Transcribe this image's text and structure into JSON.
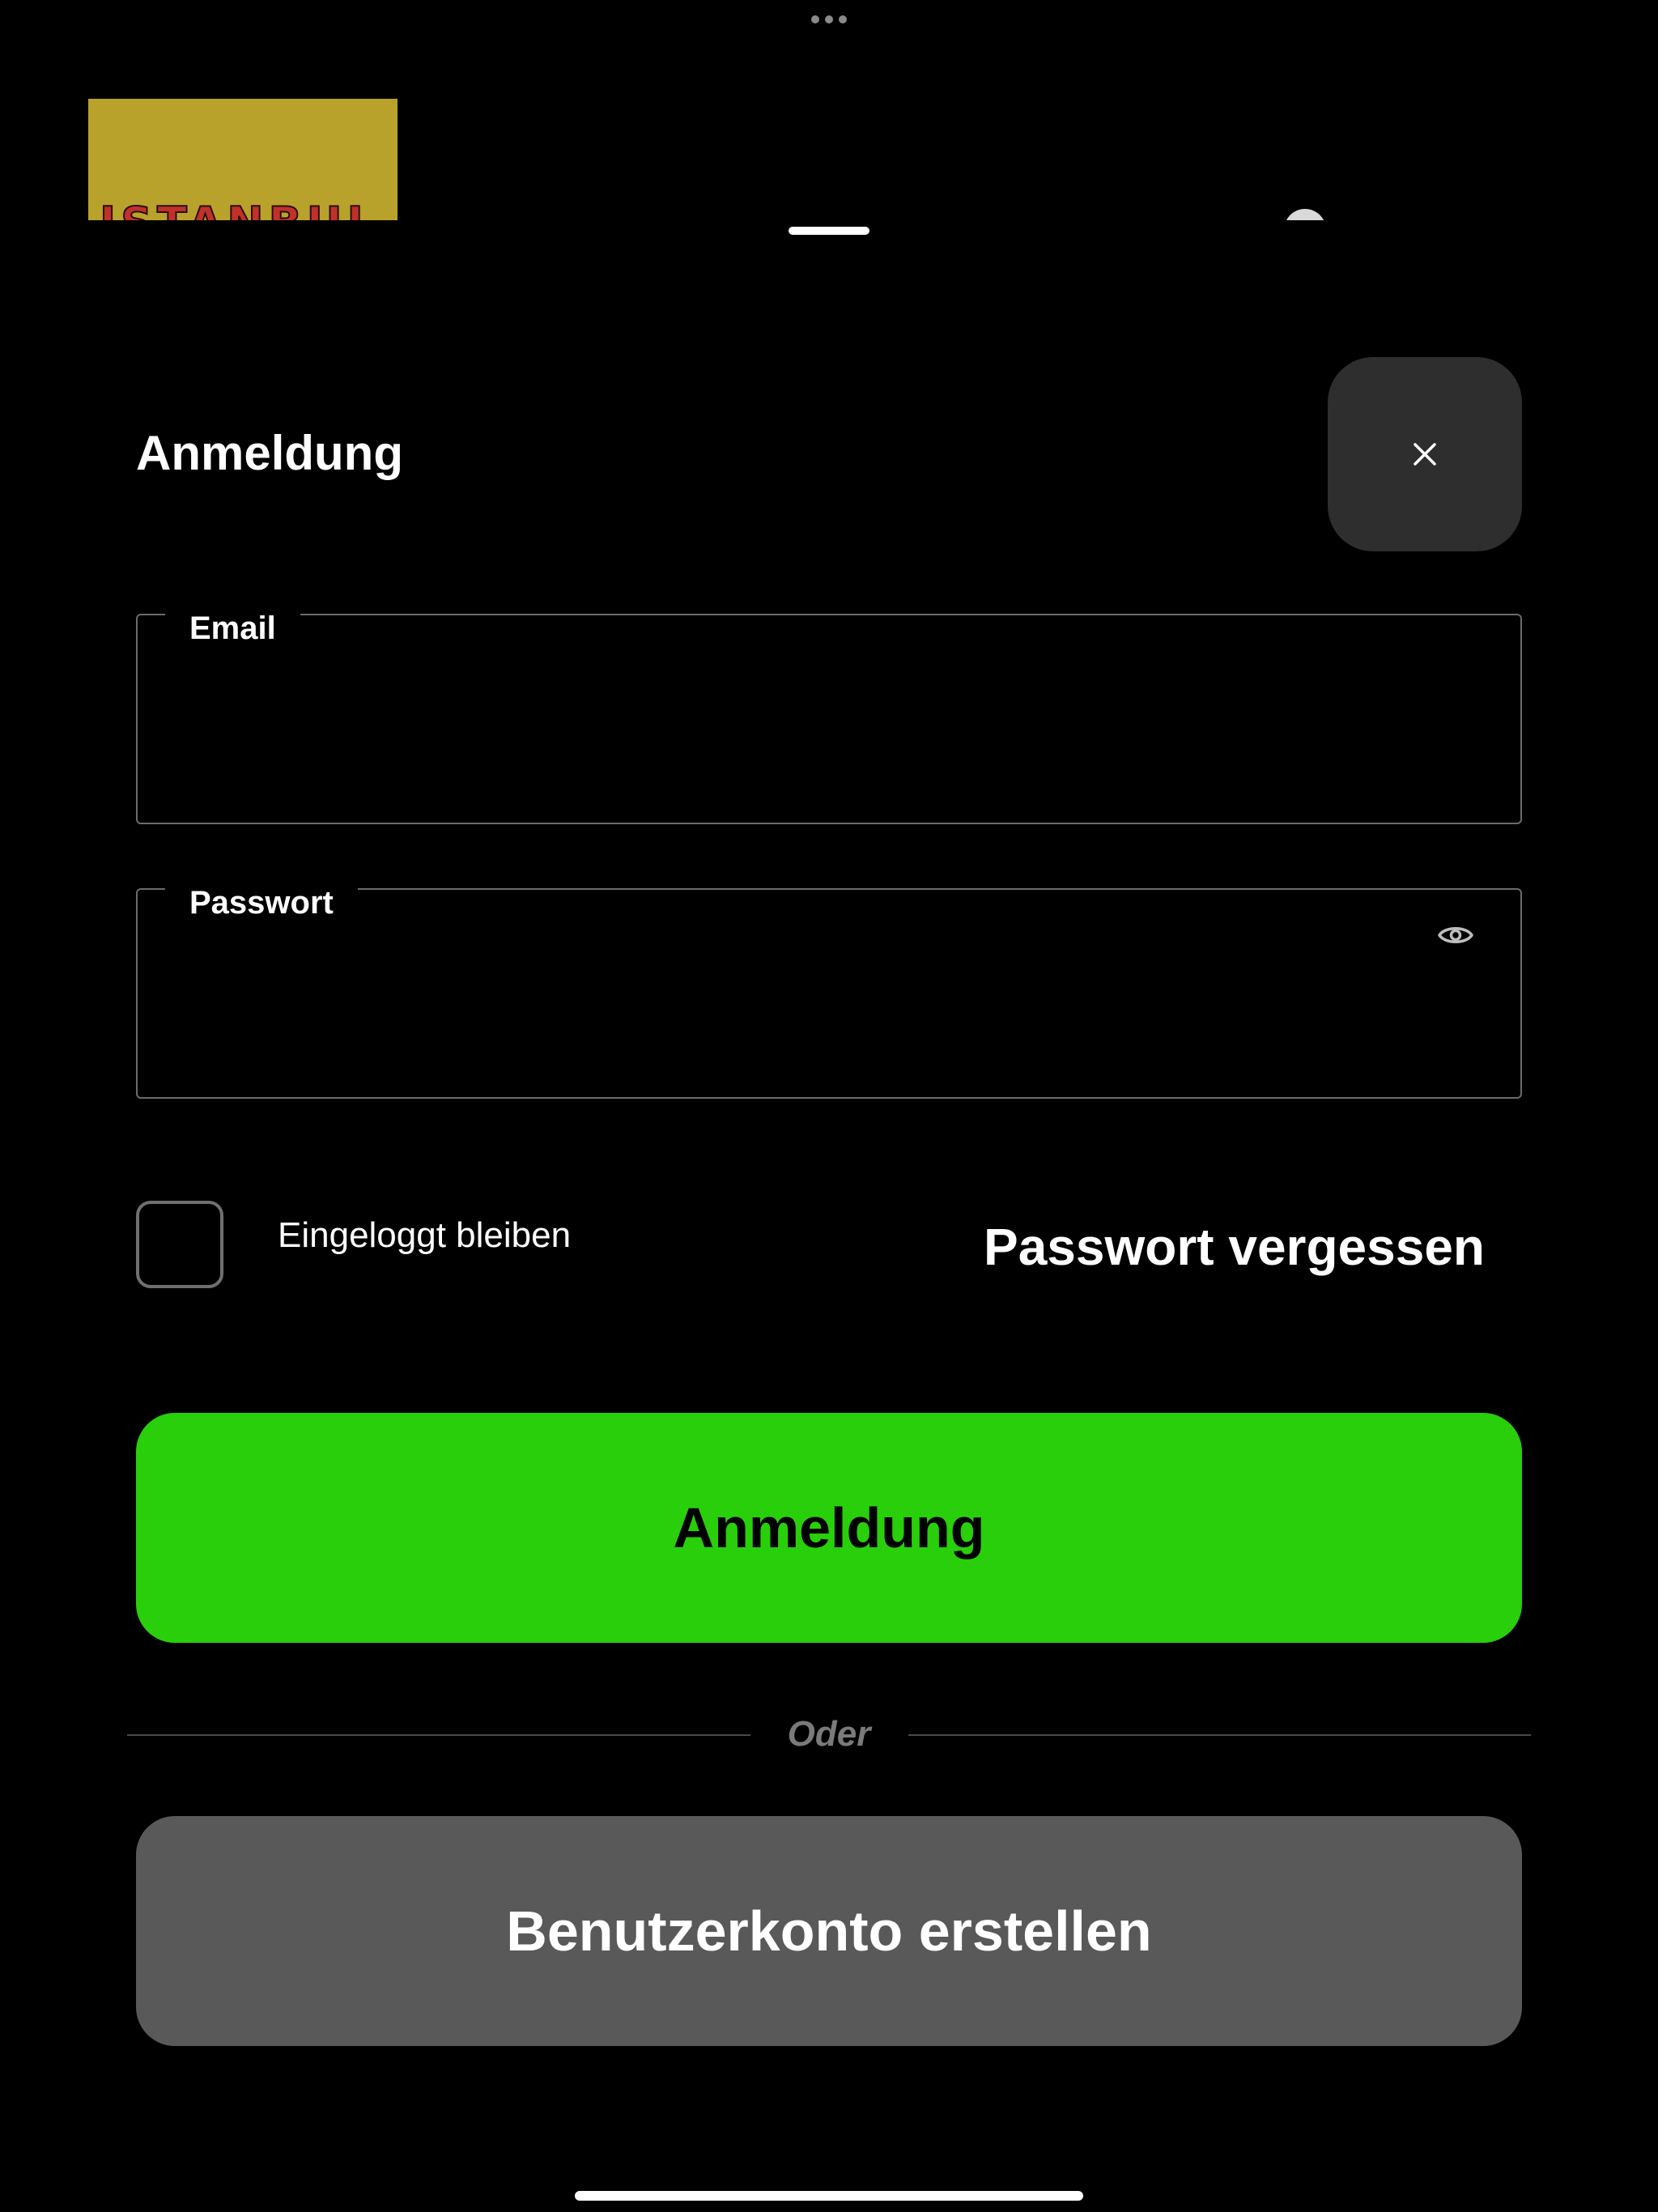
{
  "background": {
    "logo_text": "ISTANBUL"
  },
  "sheet": {
    "title": "Anmeldung",
    "close_icon": "close-icon"
  },
  "form": {
    "email_label": "Email",
    "email_value": "",
    "password_label": "Passwort",
    "password_value": "",
    "password_toggle_icon": "eye-icon",
    "remember_label": "Eingeloggt bleiben",
    "remember_checked": false,
    "forgot_label": "Passwort vergessen",
    "login_button_label": "Anmeldung",
    "divider_label": "Oder",
    "register_button_label": "Benutzerkonto erstellen"
  },
  "colors": {
    "background": "#000000",
    "primary_button": "#28cf0a",
    "secondary_button": "#595959",
    "close_button": "#2e2e2e",
    "field_border": "#6b6b6b"
  }
}
